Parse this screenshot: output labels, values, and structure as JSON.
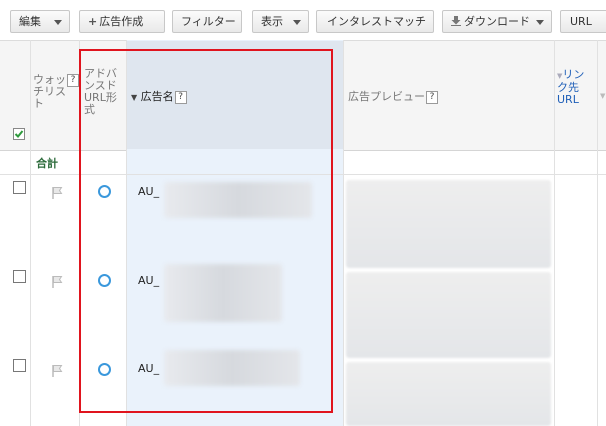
{
  "toolbar": {
    "edit": "編集",
    "create_ad": "広告作成",
    "filter": "フィルター",
    "view": "表示",
    "instream_match": "インタレストマッチ",
    "download": "ダウンロード",
    "url": "URL"
  },
  "headers": {
    "watchlist": "ウォッチリスト",
    "advanced_url": "アドバンスドURL形式",
    "ad_name": "広告名",
    "ad_preview": "広告プレビュー",
    "link_url": "リンク先URL",
    "help": "?"
  },
  "total": {
    "label": "合計"
  },
  "rows": [
    {
      "ad_name": "AU_"
    },
    {
      "ad_name": "AU_"
    },
    {
      "ad_name": "AU_"
    }
  ],
  "colors": {
    "highlight_box": "#e0141e",
    "status_dot": "#3a98dc",
    "link": "#1f5fb8"
  }
}
